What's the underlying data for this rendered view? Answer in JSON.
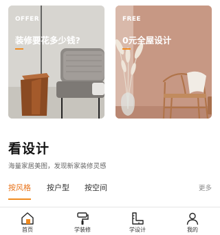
{
  "cards": [
    {
      "tag": "OFFER",
      "title": "装修要花多少钱?"
    },
    {
      "tag": "FREE",
      "title": "0元全屋设计"
    }
  ],
  "section": {
    "title": "看设计",
    "subtitle": "海量家居美图，发现新家装修灵感"
  },
  "tabs": [
    {
      "label": "按风格",
      "active": true
    },
    {
      "label": "按户型",
      "active": false
    },
    {
      "label": "按空间",
      "active": false
    }
  ],
  "more_label": "更多",
  "bottom_nav": [
    {
      "label": "首页",
      "icon": "home-icon"
    },
    {
      "label": "学装修",
      "icon": "paint-roller-icon"
    },
    {
      "label": "学设计",
      "icon": "ruler-square-icon"
    },
    {
      "label": "我的",
      "icon": "person-icon"
    }
  ],
  "colors": {
    "accent": "#f08a1f",
    "card_left_bg": "#d6d4cf",
    "card_right_bg": "#c99a86"
  }
}
